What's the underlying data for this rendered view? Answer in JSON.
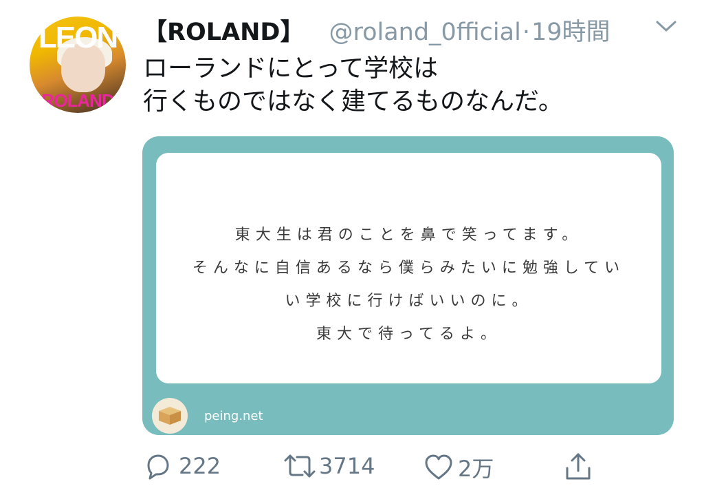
{
  "tweet": {
    "display_name": "【ROLAND】",
    "handle": "@roland_0fficial",
    "dot": "·",
    "time": "19時間",
    "text_lines": [
      "ローランドにとって学校は",
      "行くものではなく建てるものなんだ。"
    ]
  },
  "avatar": {
    "magazine_top": "LEON",
    "magazine_bottom": "ROLAND"
  },
  "card": {
    "question_lines": [
      "東大生は君のことを鼻で笑ってます。",
      "そんなに自信あるなら僕らみたいに勉強してい",
      "い学校に行けばいいのに。",
      "東大で待ってるよ。"
    ],
    "site": "peing.net",
    "bg_color": "#78bcbd"
  },
  "actions": {
    "reply_count": "222",
    "retweet_count": "3714",
    "like_count": "2万"
  },
  "icons": [
    "chevron-down-icon",
    "reply-icon",
    "retweet-icon",
    "heart-icon",
    "share-icon",
    "box-icon"
  ]
}
